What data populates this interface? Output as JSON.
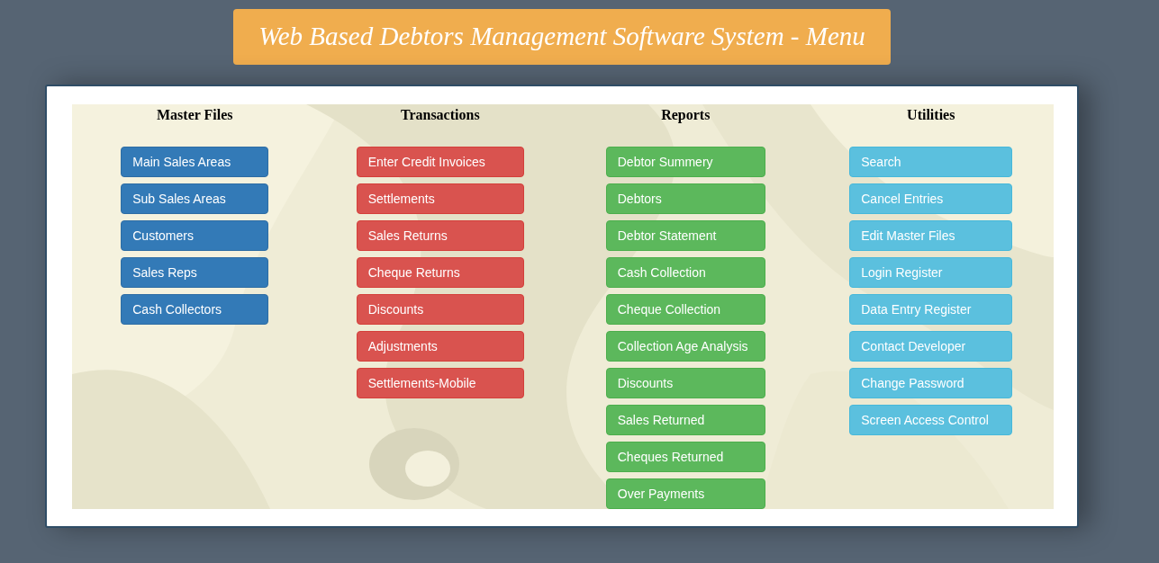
{
  "title": "Web Based Debtors Management Software System - Menu",
  "columns": [
    {
      "heading": "Master Files",
      "kind": "primary",
      "buttons": [
        "Main Sales Areas",
        "Sub Sales Areas",
        "Customers",
        "Sales Reps",
        "Cash Collectors"
      ]
    },
    {
      "heading": "Transactions",
      "kind": "danger",
      "buttons": [
        "Enter Credit Invoices",
        "Settlements",
        "Sales Returns",
        "Cheque Returns",
        "Discounts",
        "Adjustments",
        "Settlements-Mobile"
      ]
    },
    {
      "heading": "Reports",
      "kind": "success",
      "buttons": [
        "Debtor Summery",
        "Debtors",
        "Debtor Statement",
        "Cash Collection",
        "Cheque Collection",
        "Collection Age Analysis",
        "Discounts",
        "Sales Returned",
        "Cheques Returned",
        "Over Payments"
      ]
    },
    {
      "heading": "Utilities",
      "kind": "info",
      "buttons": [
        "Search",
        "Cancel Entries",
        "Edit Master Files",
        "Login Register",
        "Data Entry Register",
        "Contact Developer",
        "Change Password",
        "Screen Access Control"
      ]
    }
  ]
}
